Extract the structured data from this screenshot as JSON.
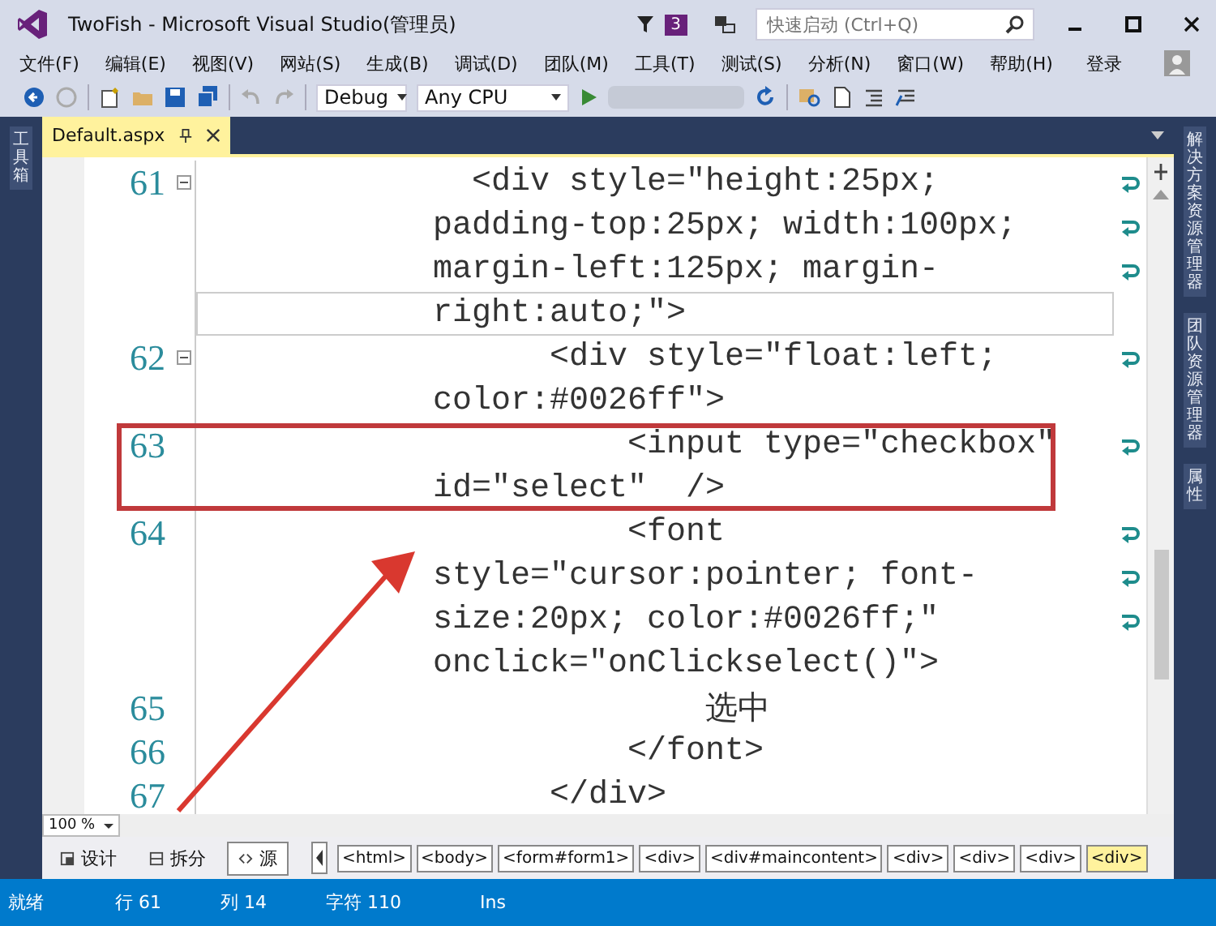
{
  "window": {
    "title": "TwoFish - Microsoft Visual Studio(管理员)",
    "notification_count": "3",
    "quick_launch": {
      "placeholder": "快速启动 (Ctrl+Q)"
    }
  },
  "menu": [
    "文件(F)",
    "编辑(E)",
    "视图(V)",
    "网站(S)",
    "生成(B)",
    "调试(D)",
    "团队(M)",
    "工具(T)",
    "测试(S)",
    "分析(N)",
    "窗口(W)",
    "帮助(H)"
  ],
  "sign_in": "登录",
  "toolbar": {
    "configuration": "Debug",
    "platform": "Any CPU"
  },
  "side_left": [
    {
      "label": "工具箱"
    }
  ],
  "side_right": [
    {
      "label": "解决方案资源管理器"
    },
    {
      "label": "团队资源管理器"
    },
    {
      "label": "属性"
    }
  ],
  "document_tabs": [
    {
      "label": "Default.aspx",
      "selected": true
    }
  ],
  "editor": {
    "zoom": "100 %",
    "lines": [
      {
        "number": "61",
        "foldable": true,
        "highlighted": false,
        "current": true,
        "segments": [
          "  <div style=\"height:25px;",
          "padding-top:25px; width:100px;",
          "margin-left:125px; margin-",
          "right:auto;\">"
        ]
      },
      {
        "number": "62",
        "foldable": true,
        "highlighted": false,
        "current": false,
        "segments": [
          "      <div style=\"float:left;",
          "color:#0026ff\">"
        ]
      },
      {
        "number": "63",
        "foldable": false,
        "highlighted": true,
        "current": false,
        "segments": [
          "          <input type=\"checkbox\"",
          "id=\"select\"  />"
        ]
      },
      {
        "number": "64",
        "foldable": false,
        "highlighted": false,
        "current": false,
        "segments": [
          "          <font",
          "style=\"cursor:pointer; font-",
          "size:20px; color:#0026ff;\"",
          "onclick=\"onClickselect()\">"
        ]
      },
      {
        "number": "65",
        "foldable": false,
        "highlighted": false,
        "current": false,
        "segments": [
          "              选中"
        ]
      },
      {
        "number": "66",
        "foldable": false,
        "highlighted": false,
        "current": false,
        "segments": [
          "          </font>"
        ]
      },
      {
        "number": "67",
        "foldable": false,
        "highlighted": false,
        "current": false,
        "segments": [
          "      </div>"
        ]
      }
    ]
  },
  "view_tabs": [
    {
      "label": "设计",
      "kind": "design",
      "selected": false
    },
    {
      "label": "拆分",
      "kind": "split",
      "selected": false
    },
    {
      "label": "源",
      "kind": "source",
      "selected": true
    }
  ],
  "breadcrumbs": [
    {
      "label": "<html>",
      "selected": false
    },
    {
      "label": "<body>",
      "selected": false
    },
    {
      "label": "<form#form1>",
      "selected": false
    },
    {
      "label": "<div>",
      "selected": false
    },
    {
      "label": "<div#maincontent>",
      "selected": false
    },
    {
      "label": "<div>",
      "selected": false
    },
    {
      "label": "<div>",
      "selected": false
    },
    {
      "label": "<div>",
      "selected": false
    },
    {
      "label": "<div>",
      "selected": true
    }
  ],
  "status_bar": {
    "state": "就绪",
    "line": "行 61",
    "column": "列 14",
    "char": "字符 110",
    "mode": "Ins"
  }
}
